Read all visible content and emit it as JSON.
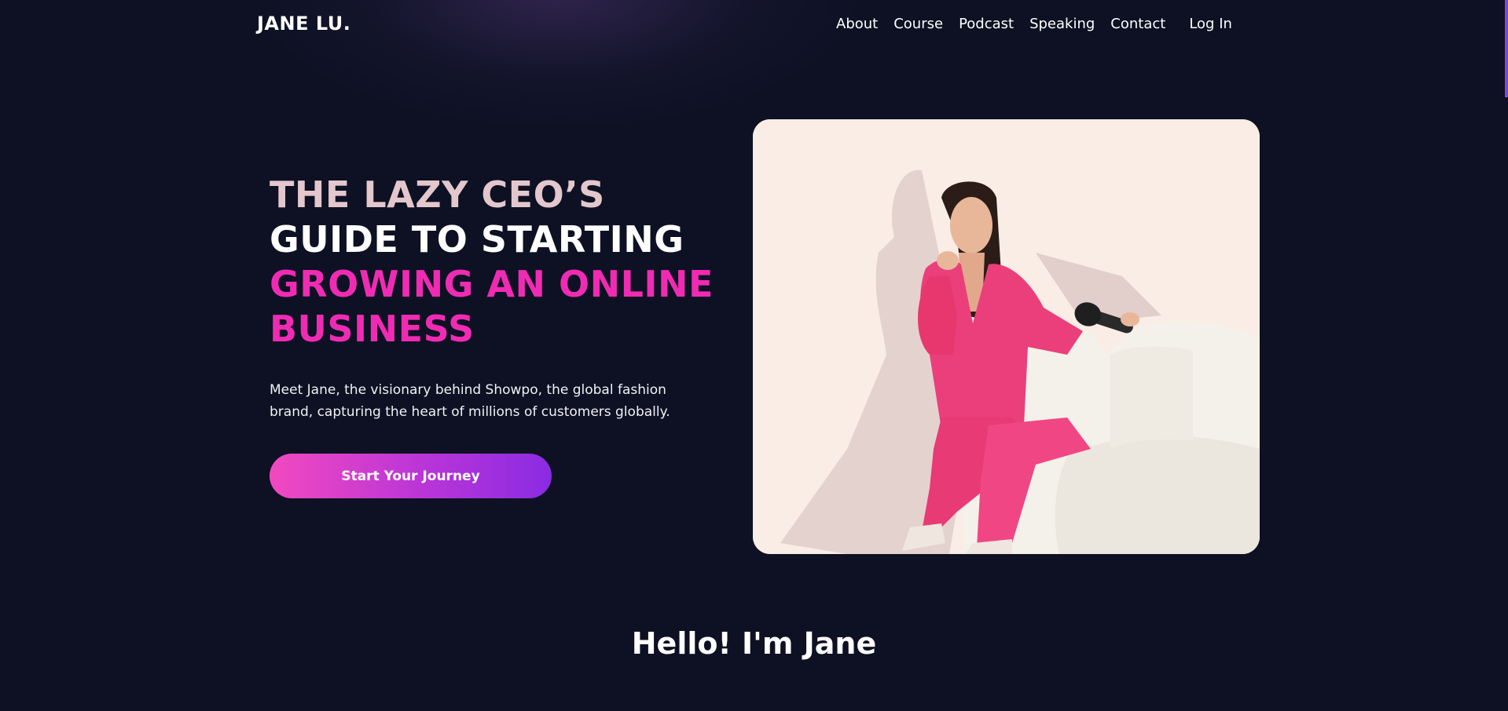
{
  "brand": {
    "logo": "JANE LU."
  },
  "nav": {
    "items": [
      {
        "label": "About"
      },
      {
        "label": "Course"
      },
      {
        "label": "Podcast"
      },
      {
        "label": "Speaking"
      },
      {
        "label": "Contact"
      }
    ],
    "login": "Log In"
  },
  "hero": {
    "headline": {
      "line1": "THE LAZY CEO’S",
      "line2": "GUIDE TO STARTING",
      "line3a": "GROWING AN ONLINE",
      "line3b": "BUSINESS"
    },
    "intro": "Meet Jane, the visionary behind Showpo, the global fashion brand, capturing the heart of millions of customers globally.",
    "cta_label": "Start Your Journey",
    "photo_alt": "Jane Lu seated on a white sofa in a pink suit holding a microphone"
  },
  "about": {
    "title": "Hello! I'm Jane"
  },
  "colors": {
    "background": "#0d1123",
    "headline_light": "#e3c7cc",
    "headline_pink": "#f02bb3",
    "cta_start": "#f249c0",
    "cta_end": "#8a2be2",
    "photo_bg": "#f9ede6"
  }
}
